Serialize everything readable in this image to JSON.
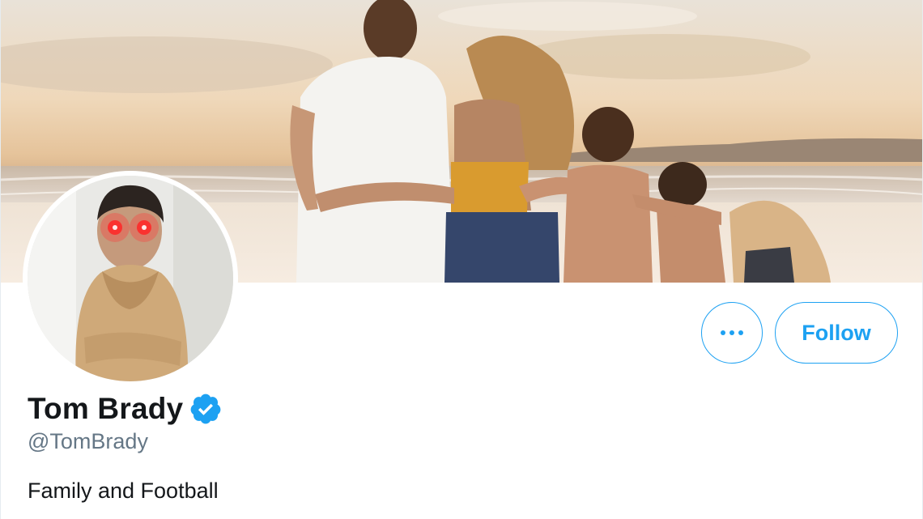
{
  "header": {
    "banner_image": "beach-family-sunset-photo"
  },
  "profile": {
    "avatar_image": "profile-photo-laser-eyes",
    "display_name": "Tom Brady",
    "verified": true,
    "handle": "@TomBrady",
    "bio": "Family and Football"
  },
  "actions": {
    "more_icon": "more-horizontal-icon",
    "follow_label": "Follow"
  },
  "colors": {
    "accent": "#1da1f2",
    "name_text": "#14171a",
    "handle_text": "#657786"
  }
}
